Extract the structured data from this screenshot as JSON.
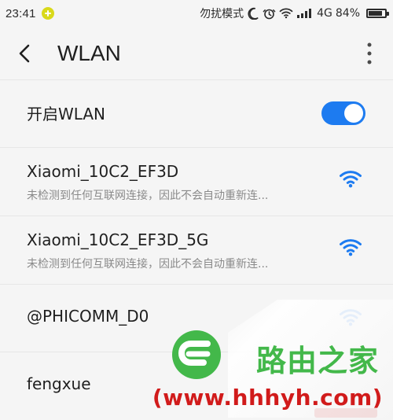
{
  "status_bar": {
    "time": "23:41",
    "mode_text": "勿扰模式",
    "network_text": "4G",
    "battery_text": "84%",
    "battery_level": 0.84
  },
  "header": {
    "title": "WLAN"
  },
  "wifi_toggle": {
    "label": "开启WLAN",
    "enabled": true
  },
  "networks": [
    {
      "ssid": "Xiaomi_10C2_EF3D",
      "subtitle": "未检测到任何互联网连接，因此不会自动重新连..."
    },
    {
      "ssid": "Xiaomi_10C2_EF3D_5G",
      "subtitle": "未检测到任何互联网连接，因此不会自动重新连..."
    },
    {
      "ssid": "@PHICOMM_D0",
      "subtitle": ""
    },
    {
      "ssid": "fengxue",
      "subtitle": ""
    }
  ],
  "watermark": {
    "brand_text": "路由之家",
    "url_text": "(www.hhhyh.com)"
  },
  "colors": {
    "accent": "#1d7bf0",
    "background": "#f5f5f5",
    "wifi": "#1d7bf0",
    "watermark_green": "#43b84a",
    "watermark_red": "#d11b1b"
  },
  "icons": {
    "back": "chevron-left-icon",
    "more": "more-vertical-icon",
    "wifi": "wifi-signal-icon",
    "dnd": "moon-icon",
    "alarm": "alarm-icon",
    "status_wifi": "wifi-status-icon",
    "signal": "cell-signal-icon",
    "battery": "battery-icon",
    "notification": "plus-badge-icon",
    "watermark_logo": "router-home-logo"
  }
}
